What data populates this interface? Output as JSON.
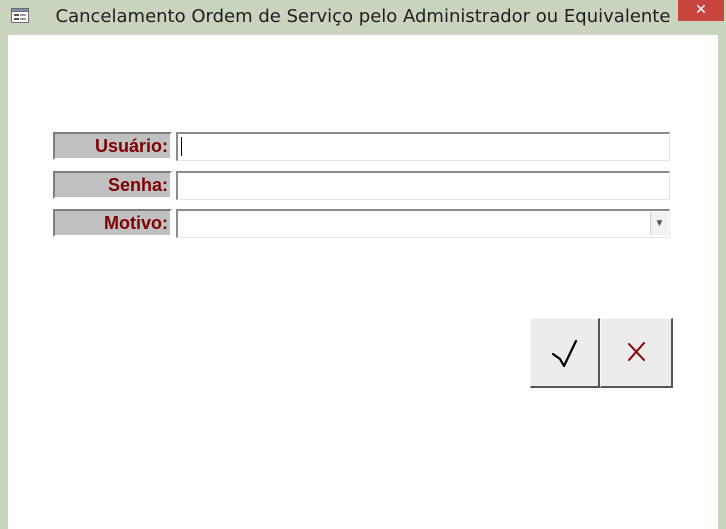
{
  "window": {
    "title": "Cancelamento Ordem de Serviço pelo Administrador ou Equivalente",
    "close_glyph": "✕",
    "app_icon": "form-window-icon"
  },
  "form": {
    "fields": [
      {
        "label": "Usuário:",
        "value": "",
        "type": "text"
      },
      {
        "label": "Senha:",
        "value": "",
        "type": "password"
      },
      {
        "label": "Motivo:",
        "value": "",
        "type": "dropdown"
      }
    ],
    "dropdown_glyph": "▼"
  },
  "actions": {
    "confirm_icon": "check-icon",
    "cancel_icon": "x-icon",
    "cancel_color": "#8b0000"
  }
}
